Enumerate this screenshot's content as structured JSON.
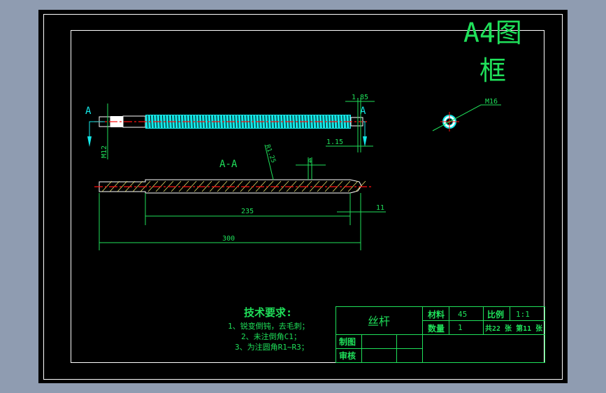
{
  "frame_title": {
    "line1": "A4图",
    "line2": "框"
  },
  "section_labels": {
    "left": "A",
    "right": "A",
    "section": "A-A"
  },
  "dimensions": {
    "m12": "M12",
    "d185": "1.85",
    "d115": "1.15",
    "r125": "R1.25",
    "d4": "4",
    "d235": "235",
    "d11": "11",
    "d300": "300",
    "m16": "M16"
  },
  "tech_requirements": {
    "title": "技术要求:",
    "items": [
      "1、锐变倒钝，去毛刺；",
      "2、未注倒角C1；",
      "3、为注圆角R1~R3；"
    ]
  },
  "title_block": {
    "part_name": "丝杆",
    "material_label": "材料",
    "material_value": "45",
    "scale_label": "比例",
    "scale_value": "1:1",
    "quantity_label": "数量",
    "quantity_value": "1",
    "sheets": "共22 张  第11 张",
    "drawn_label": "制图",
    "checked_label": "审核"
  },
  "colors": {
    "drawing": "#1fe05a",
    "center": "#ff1010",
    "thread": "#14e8e8",
    "background": "#000000"
  }
}
